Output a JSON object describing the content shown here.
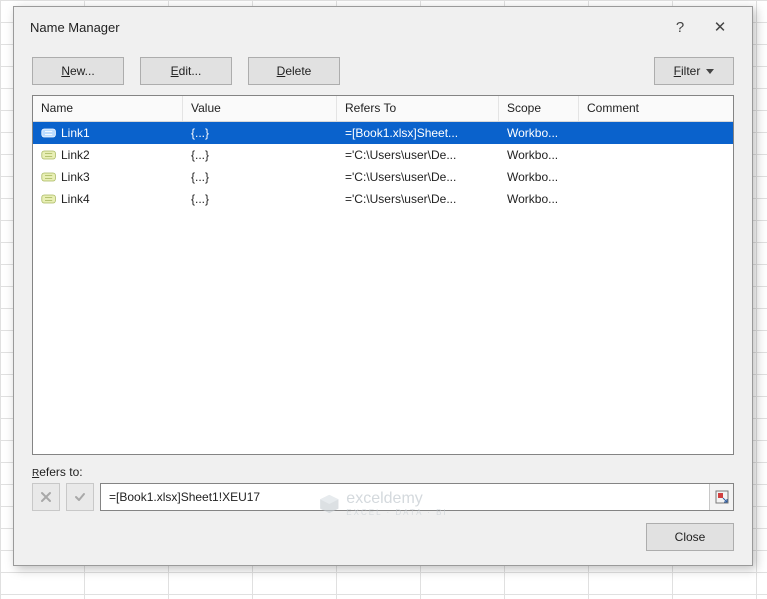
{
  "dialog": {
    "title": "Name Manager",
    "help_label": "?",
    "close_label": "✕"
  },
  "toolbar": {
    "new_label": "New...",
    "edit_label": "Edit...",
    "delete_label": "Delete",
    "filter_label": "Filter"
  },
  "columns": {
    "name": "Name",
    "value": "Value",
    "refers": "Refers To",
    "scope": "Scope",
    "comment": "Comment"
  },
  "rows": [
    {
      "name": "Link1",
      "value": "{...}",
      "refers": "=[Book1.xlsx]Sheet...",
      "scope": "Workbo...",
      "comment": "",
      "selected": true,
      "broken": true
    },
    {
      "name": "Link2",
      "value": "{...}",
      "refers": "='C:\\Users\\user\\De...",
      "scope": "Workbo...",
      "comment": "",
      "selected": false,
      "broken": false
    },
    {
      "name": "Link3",
      "value": "{...}",
      "refers": "='C:\\Users\\user\\De...",
      "scope": "Workbo...",
      "comment": "",
      "selected": false,
      "broken": false
    },
    {
      "name": "Link4",
      "value": "{...}",
      "refers": "='C:\\Users\\user\\De...",
      "scope": "Workbo...",
      "comment": "",
      "selected": false,
      "broken": false
    }
  ],
  "refersto": {
    "label": "Refers to:",
    "value": "=[Book1.xlsx]Sheet1!XEU17"
  },
  "bottom": {
    "close_label": "Close"
  },
  "watermark": {
    "brand": "exceldemy",
    "tagline": "EXCEL · DATA · BI"
  }
}
